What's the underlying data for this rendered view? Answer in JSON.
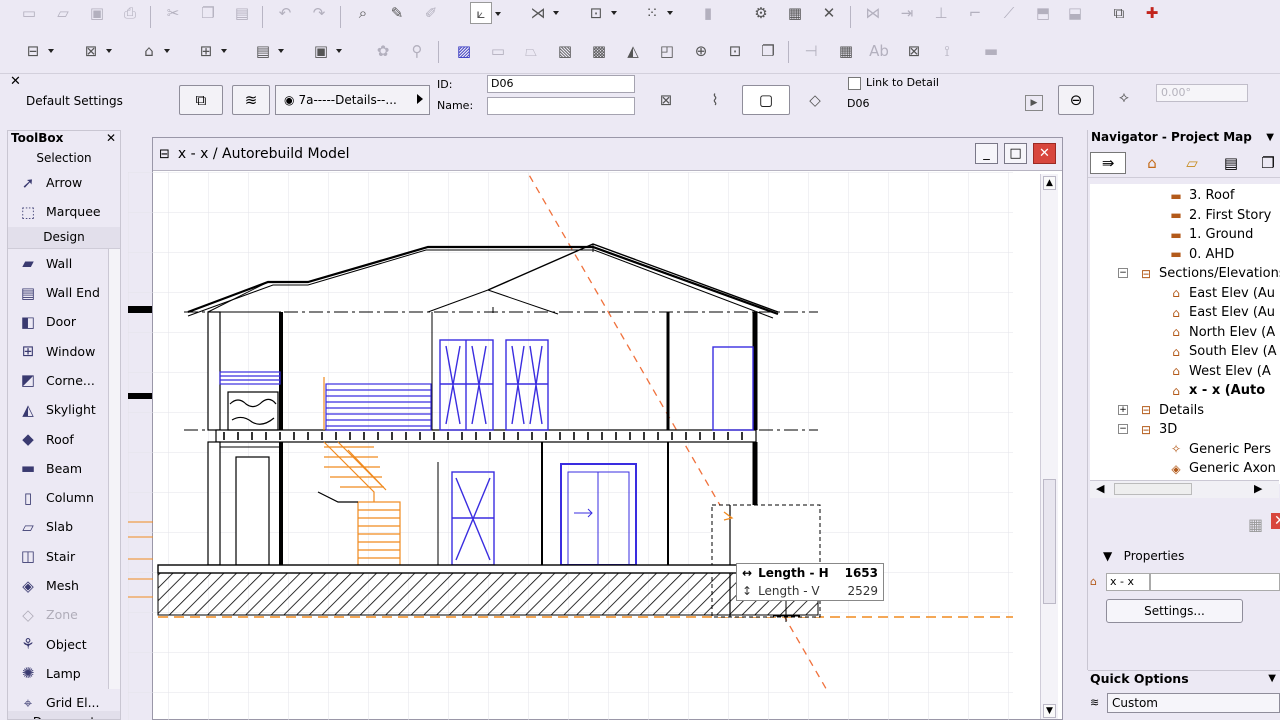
{
  "toolbox": {
    "title": "ToolBox",
    "section_selection": "Selection",
    "section_design": "Design",
    "selection_tools": [
      {
        "label": "Arrow",
        "icon": "arrow-cursor-icon"
      },
      {
        "label": "Marquee",
        "icon": "marquee-icon"
      }
    ],
    "design_tools": [
      {
        "label": "Wall",
        "icon": "wall-icon",
        "enabled": true
      },
      {
        "label": "Wall End",
        "icon": "wall-end-icon",
        "enabled": true
      },
      {
        "label": "Door",
        "icon": "door-icon",
        "enabled": true
      },
      {
        "label": "Window",
        "icon": "window-icon",
        "enabled": true
      },
      {
        "label": "Corne...",
        "icon": "corner-window-icon",
        "enabled": true
      },
      {
        "label": "Skylight",
        "icon": "skylight-icon",
        "enabled": true
      },
      {
        "label": "Roof",
        "icon": "roof-icon",
        "enabled": true
      },
      {
        "label": "Beam",
        "icon": "beam-icon",
        "enabled": true
      },
      {
        "label": "Column",
        "icon": "column-icon",
        "enabled": true
      },
      {
        "label": "Slab",
        "icon": "slab-icon",
        "enabled": true
      },
      {
        "label": "Stair",
        "icon": "stair-icon",
        "enabled": true
      },
      {
        "label": "Mesh",
        "icon": "mesh-icon",
        "enabled": true
      },
      {
        "label": "Zone",
        "icon": "zone-icon",
        "enabled": false
      },
      {
        "label": "Object",
        "icon": "object-icon",
        "enabled": true
      },
      {
        "label": "Lamp",
        "icon": "lamp-icon",
        "enabled": true
      },
      {
        "label": "Grid El...",
        "icon": "grid-element-icon",
        "enabled": true
      }
    ],
    "section_document": "Document"
  },
  "infobox": {
    "default_settings": "Default Settings",
    "layer": "7a-----Details--...",
    "id_label": "ID:",
    "id_value": "D06",
    "name_label": "Name:",
    "name_value": "",
    "link_to_detail": "Link to Detail",
    "detail_ref": "D06",
    "angle": "0.00°"
  },
  "window": {
    "title": "x - x  / Autorebuild Model"
  },
  "tracker": {
    "length_h_label": "Length - H",
    "length_h_value": "1653",
    "length_v_label": "Length - V",
    "length_v_value": "2529"
  },
  "navigator": {
    "title": "Navigator - Project Map",
    "tree": [
      {
        "label": "3. Roof",
        "icon": "story-icon"
      },
      {
        "label": "2. First Story",
        "icon": "story-icon"
      },
      {
        "label": "1. Ground",
        "icon": "story-icon"
      },
      {
        "label": "0. AHD",
        "icon": "story-icon"
      },
      {
        "label": "Sections/Elevations",
        "icon": "section-folder-icon"
      },
      {
        "label": "East Elev (Au",
        "icon": "elevation-icon"
      },
      {
        "label": "East Elev (Au",
        "icon": "elevation-icon"
      },
      {
        "label": "North Elev (A",
        "icon": "elevation-icon"
      },
      {
        "label": "South Elev (A",
        "icon": "elevation-icon"
      },
      {
        "label": "West Elev (A",
        "icon": "elevation-icon"
      },
      {
        "label": "x - x (Auto",
        "icon": "section-icon"
      },
      {
        "label": "Details",
        "icon": "details-folder-icon"
      },
      {
        "label": "3D",
        "icon": "3d-folder-icon"
      },
      {
        "label": "Generic Pers",
        "icon": "perspective-icon"
      },
      {
        "label": "Generic Axon",
        "icon": "axonometry-icon"
      }
    ],
    "properties_label": "Properties",
    "properties_value": "x - x",
    "settings_button": "Settings...",
    "quick_options_title": "Quick Options",
    "quick_options_value": "Custom"
  },
  "colors": {
    "chrome": "#ece9f4",
    "accent_blue": "#3a2de0",
    "stair_orange": "#f08a1f",
    "close_red": "#d8463d"
  }
}
